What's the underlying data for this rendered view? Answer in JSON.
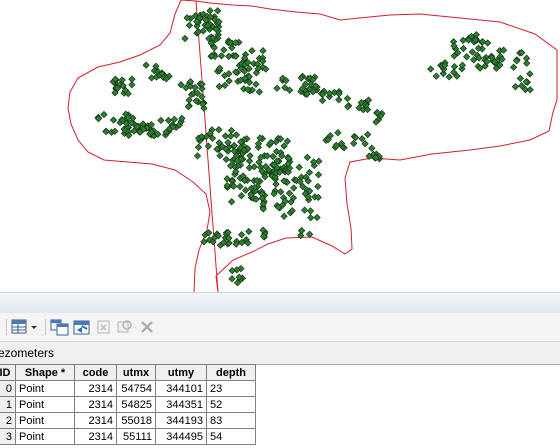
{
  "map": {
    "boundary_color": "#d21f2b",
    "point_fill": "#2e7d32",
    "point_stroke": "#0b2a0b"
  },
  "toolbar": {
    "buttons": [
      {
        "name": "table-options-icon",
        "enabled": true
      },
      {
        "name": "related-tables-icon",
        "enabled": true
      },
      {
        "name": "select-by-attributes-icon",
        "enabled": true
      },
      {
        "name": "switch-selection-icon",
        "enabled": true
      },
      {
        "name": "clear-selection-icon",
        "enabled": false
      },
      {
        "name": "zoom-to-selected-icon",
        "enabled": false
      },
      {
        "name": "delete-selected-icon",
        "enabled": false
      }
    ]
  },
  "table": {
    "title": "ezometers",
    "columns": [
      "ID",
      "Shape *",
      "code",
      "utmx",
      "utmy",
      "depth"
    ],
    "rows": [
      [
        "0",
        "Point",
        "2314",
        "54754",
        "344101",
        "23"
      ],
      [
        "1",
        "Point",
        "2314",
        "54825",
        "344351",
        "52"
      ],
      [
        "2",
        "Point",
        "2314",
        "55018",
        "344193",
        "83"
      ],
      [
        "3",
        "Point",
        "2314",
        "55111",
        "344495",
        "54"
      ]
    ]
  }
}
